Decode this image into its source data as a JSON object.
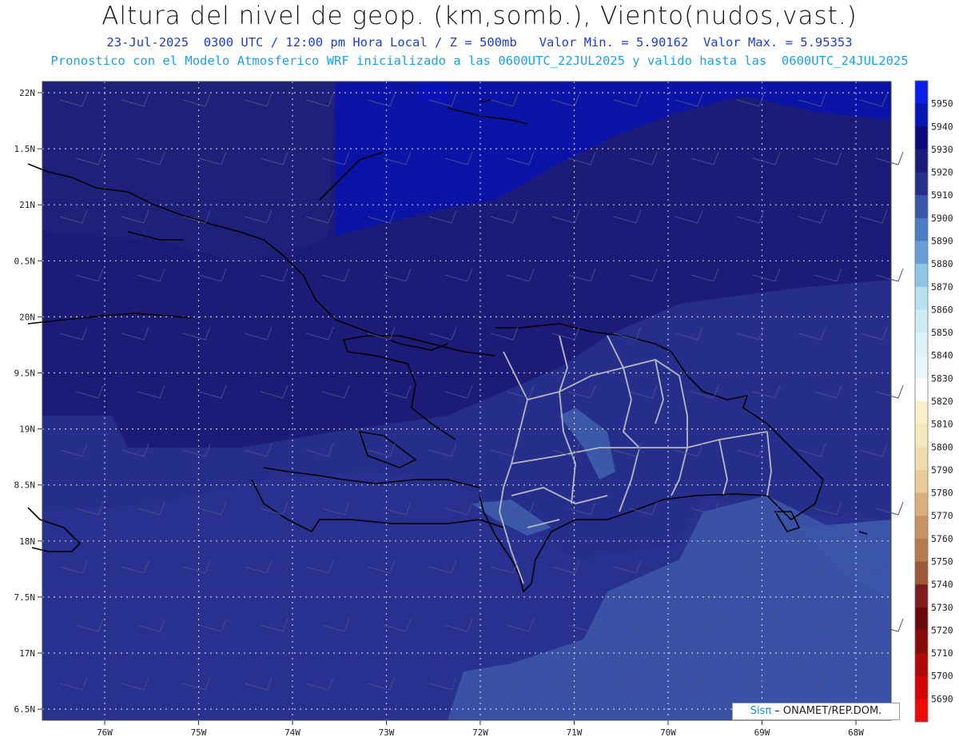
{
  "header": {
    "title": "Altura del nivel de geop. (km,somb.), Viento(nudos,vast.)",
    "line1": "23-Jul-2025  0300 UTC / 12:00 pm Hora Local / Z = 500mb   Valor Min. = 5.90162  Valor Max. = 5.95353",
    "line2": "Pronostico con el Modelo Atmosferico WRF inicializado a las 0600UTC_22JUL2025 y valido hasta las  0600UTC_24JUL2025"
  },
  "lat_labels": [
    "22N",
    "1.5N",
    "21N",
    "0.5N",
    "20N",
    "9.5N",
    "19N",
    "8.5N",
    "18N",
    "7.5N",
    "17N",
    "6.5N"
  ],
  "lon_labels": [
    "76W",
    "75W",
    "74W",
    "73W",
    "72W",
    "71W",
    "70W",
    "69W",
    "68W"
  ],
  "colorbar": {
    "labels": [
      "5950",
      "5940",
      "5930",
      "5920",
      "5910",
      "5900",
      "5890",
      "5880",
      "5870",
      "5860",
      "5850",
      "5840",
      "5830",
      "5820",
      "5810",
      "5800",
      "5790",
      "5780",
      "5770",
      "5760",
      "5750",
      "5740",
      "5730",
      "5720",
      "5710",
      "5700",
      "5690"
    ],
    "colors": [
      "#0a1ee6",
      "#0616b4",
      "#0b0b7e",
      "#1c1c78",
      "#26308a",
      "#3a56a6",
      "#4c7cc4",
      "#6a9fd6",
      "#8ec6e6",
      "#b6e0f0",
      "#cdecf5",
      "#dcf2f8",
      "#e6f6fa",
      "#ffffff",
      "#f8f0cc",
      "#f4e8bc",
      "#efdcae",
      "#e8cc98",
      "#d9b07a",
      "#c99462",
      "#b67a4c",
      "#9c5838",
      "#7e1e1c",
      "#6a0a0a",
      "#8a0c0a",
      "#b00806",
      "#d40404",
      "#ee0808"
    ]
  },
  "legend_colors": {
    "land_outline": "#000000",
    "province_lines": "#b8b8c0",
    "grid": "#ffffff"
  },
  "credit": {
    "sis": "Sisπ",
    "rest": " – ONAMET/REP.DOM."
  }
}
